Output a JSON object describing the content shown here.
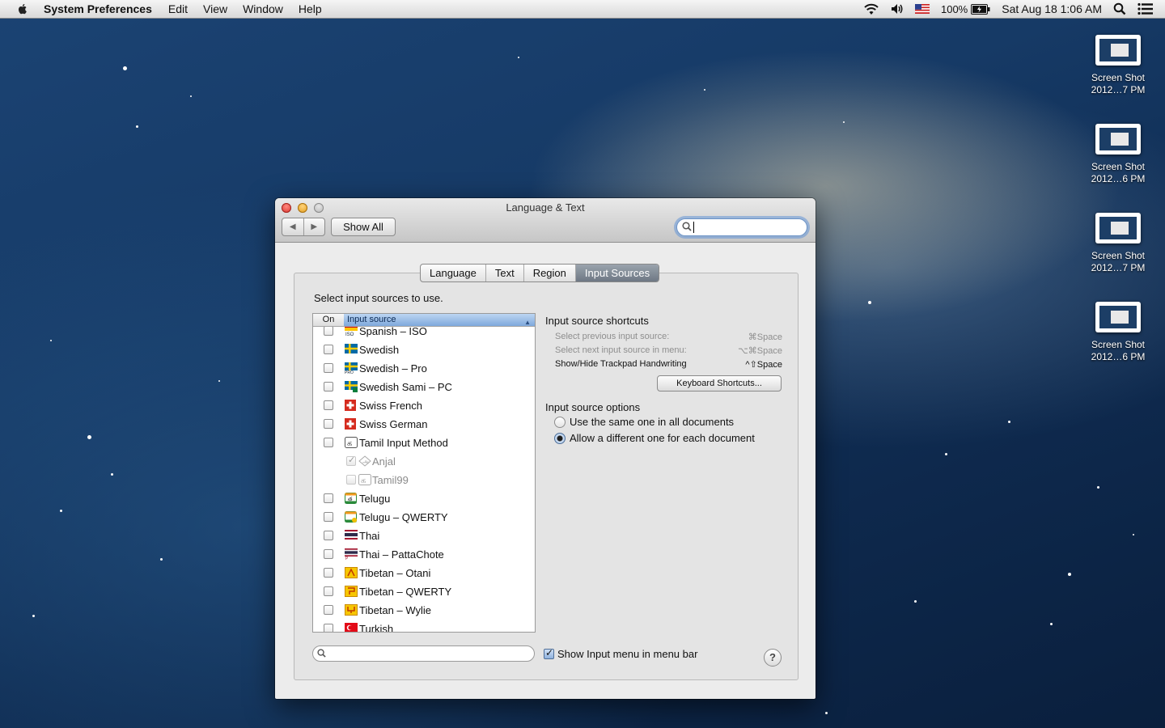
{
  "menubar": {
    "app_name": "System Preferences",
    "menus": [
      "Edit",
      "View",
      "Window",
      "Help"
    ],
    "battery": "100%",
    "clock": "Sat Aug 18  1:06 AM"
  },
  "desktop": {
    "icons": [
      {
        "line1": "Screen Shot",
        "line2": "2012…7 PM"
      },
      {
        "line1": "Screen Shot",
        "line2": "2012…6 PM"
      },
      {
        "line1": "Screen Shot",
        "line2": "2012…7 PM"
      },
      {
        "line1": "Screen Shot",
        "line2": "2012…6 PM"
      }
    ]
  },
  "window": {
    "title": "Language & Text",
    "show_all": "Show All",
    "back_glyph": "◀",
    "forward_glyph": "▶",
    "tabs": [
      "Language",
      "Text",
      "Region",
      "Input Sources"
    ],
    "selected_tab": "Input Sources",
    "prompt": "Select input sources to use.",
    "list": {
      "col_on": "On",
      "col_source": "Input source",
      "rows": [
        {
          "label": "Spanish – ISO",
          "icon": "spain-flag-iso-icon",
          "checked": false,
          "sub": false
        },
        {
          "label": "Swedish",
          "icon": "sweden-flag-icon",
          "checked": false,
          "sub": false
        },
        {
          "label": "Swedish – Pro",
          "icon": "sweden-flag-pro-icon",
          "checked": false,
          "sub": false
        },
        {
          "label": "Swedish Sami – PC",
          "icon": "sweden-flag-sami-icon",
          "checked": false,
          "sub": false
        },
        {
          "label": "Swiss French",
          "icon": "swiss-flag-icon",
          "checked": false,
          "sub": false
        },
        {
          "label": "Swiss German",
          "icon": "swiss-flag-icon",
          "checked": false,
          "sub": false
        },
        {
          "label": "Tamil Input Method",
          "icon": "tamil-input-icon",
          "checked": false,
          "sub": false
        },
        {
          "label": "Anjal",
          "icon": "anjal-icon",
          "checked": true,
          "sub": true
        },
        {
          "label": "Tamil99",
          "icon": "tamil99-icon",
          "checked": false,
          "sub": true
        },
        {
          "label": "Telugu",
          "icon": "telugu-icon",
          "checked": false,
          "sub": false
        },
        {
          "label": "Telugu – QWERTY",
          "icon": "telugu-qwerty-icon",
          "checked": false,
          "sub": false
        },
        {
          "label": "Thai",
          "icon": "thai-flag-icon",
          "checked": false,
          "sub": false
        },
        {
          "label": "Thai – PattaChote",
          "icon": "thai-flag-pattachote-icon",
          "checked": false,
          "sub": false
        },
        {
          "label": "Tibetan – Otani",
          "icon": "tibetan-otani-icon",
          "checked": false,
          "sub": false
        },
        {
          "label": "Tibetan – QWERTY",
          "icon": "tibetan-qwerty-icon",
          "checked": false,
          "sub": false
        },
        {
          "label": "Tibetan – Wylie",
          "icon": "tibetan-wylie-icon",
          "checked": false,
          "sub": false
        },
        {
          "label": "Turkish",
          "icon": "turkey-flag-icon",
          "checked": false,
          "sub": false
        }
      ]
    },
    "shortcuts": {
      "title": "Input source shortcuts",
      "items": [
        {
          "label": "Select previous input source:",
          "keys": "⌘Space",
          "enabled": false
        },
        {
          "label": "Select next input source in menu:",
          "keys": "⌥⌘Space",
          "enabled": false
        },
        {
          "label": "Show/Hide Trackpad Handwriting",
          "keys": "^⇧Space",
          "enabled": true
        }
      ],
      "button": "Keyboard Shortcuts..."
    },
    "options": {
      "title": "Input source options",
      "radios": [
        {
          "label": "Use the same one in all documents",
          "selected": false
        },
        {
          "label": "Allow a different one for each document",
          "selected": true
        }
      ]
    },
    "show_input_menu": "Show Input menu in menu bar",
    "show_input_menu_checked": true,
    "help": "?"
  }
}
